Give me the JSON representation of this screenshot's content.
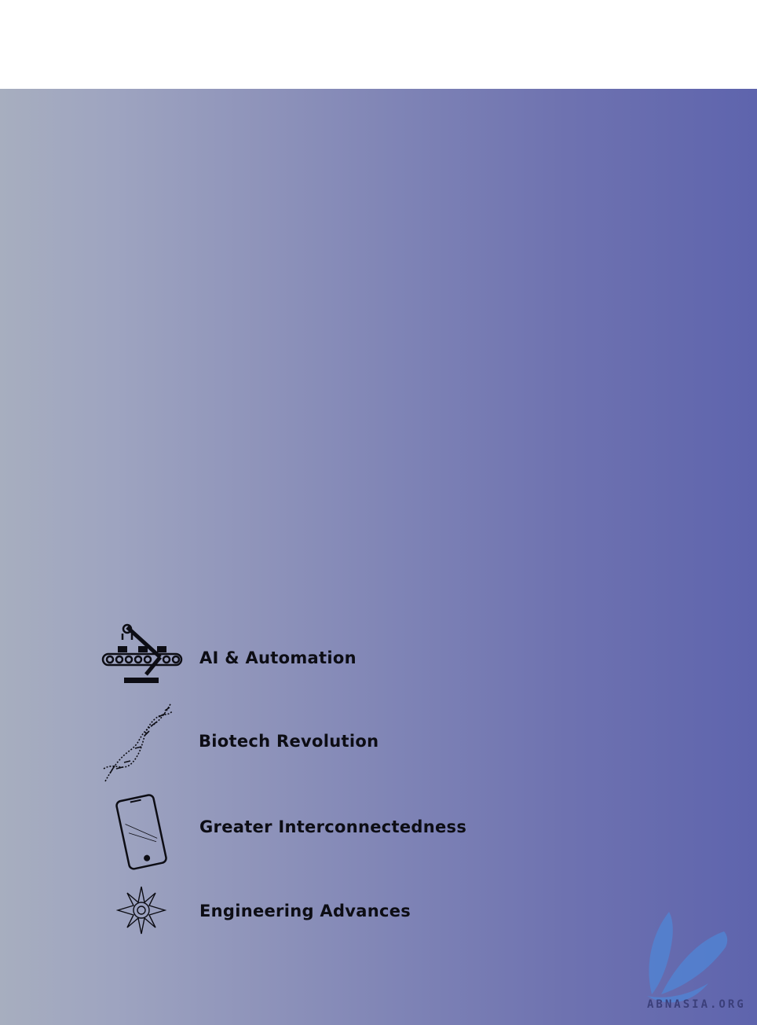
{
  "features": [
    {
      "icon": "robot-arm-conveyor-icon",
      "label": "AI & Automation"
    },
    {
      "icon": "dna-helix-icon",
      "label": "Biotech Revolution"
    },
    {
      "icon": "smartphone-icon",
      "label": "Greater Interconnectedness"
    },
    {
      "icon": "starburst-icon",
      "label": "Engineering Advances"
    }
  ],
  "watermark": {
    "text": "ABNASIA.ORG",
    "icon": "feather-logo-icon"
  },
  "colors": {
    "gradient_left": "#a7aebf",
    "gradient_right": "#5e64ad",
    "text": "#0d0d14"
  }
}
